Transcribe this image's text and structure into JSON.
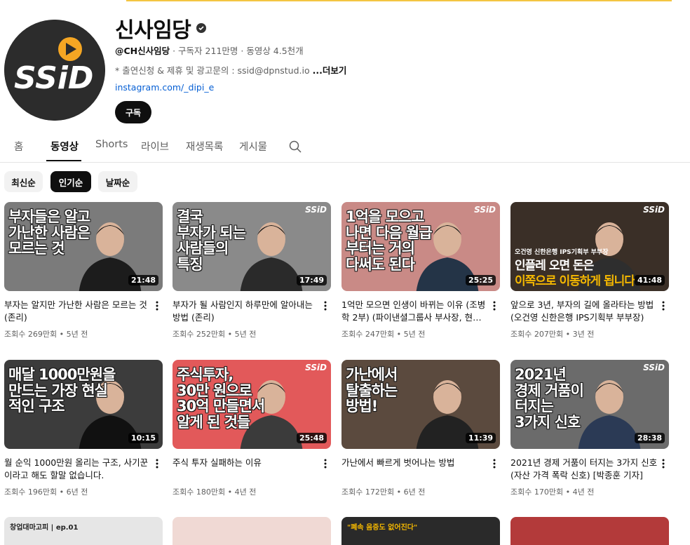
{
  "channel": {
    "name": "신사임당",
    "handle": "@CH신사임당",
    "stats": " · 구독자 211만명 · 동영상 4.5천개",
    "description": "* 출연신청 & 제휴 및 광고문의 : ssid@dpnstud.io",
    "more_label": "...더보기",
    "link": "instagram.com/_dipi_e",
    "subscribe_label": "구독",
    "avatar_text": "SSiD"
  },
  "tabs": [
    "홈",
    "동영상",
    "Shorts",
    "라이브",
    "재생목록",
    "게시물"
  ],
  "active_tab": "동영상",
  "chips": [
    "최신순",
    "인기순",
    "날짜순"
  ],
  "active_chip": "인기순",
  "videos": [
    {
      "title": "부자는 알지만 가난한 사람은 모르는 것 (존리)",
      "meta": "조회수 269만회 • 5년 전",
      "duration": "21:48",
      "headline": "부자들은 알고\n가난한 사람은\n모르는 것",
      "bg": "#7b7b7b",
      "logo": ""
    },
    {
      "title": "부자가 될 사람인지 하루만에 알아내는 방법 (존리)",
      "meta": "조회수 252만회 • 5년 전",
      "duration": "17:49",
      "headline": "결국\n부자가 되는\n사람들의\n특징",
      "bg": "#8a8a8a",
      "logo": "SSiD"
    },
    {
      "title": "1억만 모으면 인생이 바뀌는 이유 (조병학 2부) (파이낸셜그룹사 부사장, 현대...",
      "meta": "조회수 247만회 • 5년 전",
      "duration": "25:25",
      "headline": "1억을 모으고\n나면 다음 월급\n부터는 거의\n다써도 된다",
      "bg": "#c98a86",
      "logo": "SSiD"
    },
    {
      "title": "앞으로 3년, 부자의 길에 올라타는 방법 (오건영 신한은행 IPS기획부 부부장)",
      "meta": "조회수 207만회 • 3년 전",
      "duration": "41:48",
      "headline": "",
      "bg": "#3a2f27",
      "logo": "SSiD"
    },
    {
      "title": "월 순익 1000만원 올리는 구조, 사기꾼이라고 해도 할말 없습니다.",
      "meta": "조회수 196만회 • 6년 전",
      "duration": "10:15",
      "headline": "매달 1000만원을\n만드는 가장 현실\n적인 구조",
      "bg": "#3c3c3c",
      "logo": ""
    },
    {
      "title": "주식 투자 실패하는 이유",
      "meta": "조회수 180만회 • 4년 전",
      "duration": "25:48",
      "headline": "주식투자,\n30만 원으로\n30억 만들면서\n알게 된 것들",
      "bg": "#e2595a",
      "logo": "SSiD"
    },
    {
      "title": "가난에서 빠르게 벗어나는 방법",
      "meta": "조회수 172만회 • 6년 전",
      "duration": "11:39",
      "headline": "가난에서\n탈출하는\n방법!",
      "bg": "#5b4a3e",
      "logo": ""
    },
    {
      "title": "2021년 경제 거품이 터지는 3가지 신호 (자산 가격 폭락 신호) [박종훈 기자]",
      "meta": "조회수 170만회 • 4년 전",
      "duration": "28:38",
      "headline": "2021년\n경제 거품이\n터지는\n3가지 신호",
      "bg": "#6b6b6b",
      "logo": "SSiD"
    }
  ],
  "thumb4_caption": "오건영 신한은행 IPS기획부 부부장",
  "thumb4_headline_1": "인플레 오면 돈은",
  "thumb4_headline_2": "이쪽으로 이동하게 됩니다",
  "partial_row": [
    {
      "text": "창업대마고피 | ep.01",
      "bg": "#e6e6e6"
    },
    {
      "text": "",
      "bg": "#f0d9d4"
    },
    {
      "text": "\"폐속 음증도 없어진다\"",
      "bg": "#2a2a2a"
    },
    {
      "text": "",
      "bg": "#b33a3a"
    }
  ]
}
